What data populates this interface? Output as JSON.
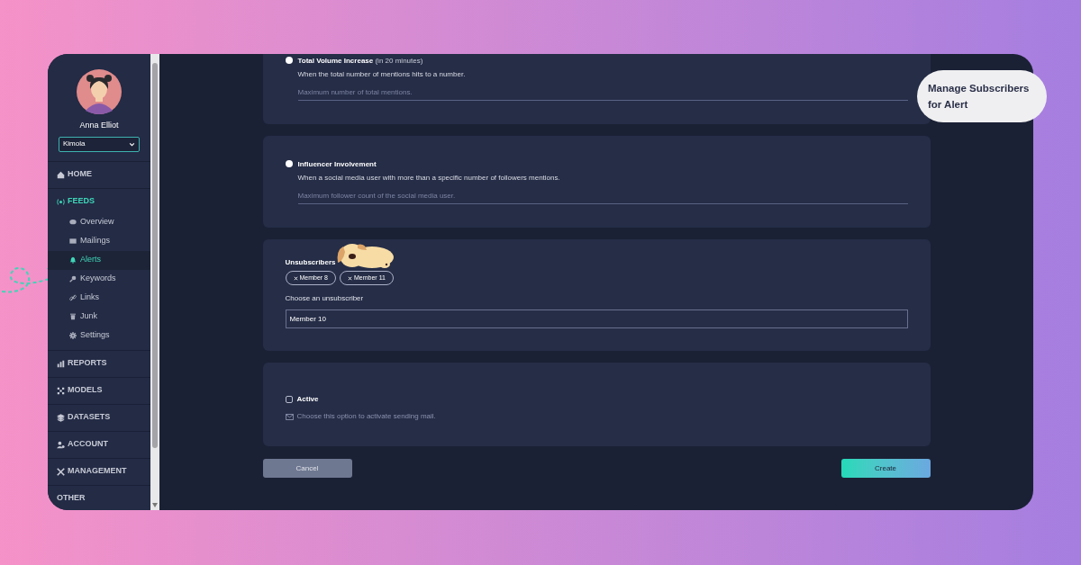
{
  "user": {
    "name": "Anna Elliot"
  },
  "workspace_select": {
    "value": "Kimola"
  },
  "nav": [
    {
      "label": "HOME",
      "selected": false
    },
    {
      "label": "FEEDS",
      "selected": true,
      "children": [
        {
          "label": "Overview",
          "selected": false
        },
        {
          "label": "Mailings",
          "selected": false
        },
        {
          "label": "Alerts",
          "selected": true
        },
        {
          "label": "Keywords",
          "selected": false
        },
        {
          "label": "Links",
          "selected": false
        },
        {
          "label": "Junk",
          "selected": false
        },
        {
          "label": "Settings",
          "selected": false
        }
      ]
    },
    {
      "label": "REPORTS",
      "selected": false
    },
    {
      "label": "MODELS",
      "selected": false
    },
    {
      "label": "DATASETS",
      "selected": false
    },
    {
      "label": "ACCOUNT",
      "selected": false
    },
    {
      "label": "MANAGEMENT",
      "selected": false
    },
    {
      "label": "OTHER",
      "selected": false
    }
  ],
  "alert_options": [
    {
      "title": "Total Volume Increase",
      "note": "(in 20 minutes)",
      "description": "When the total number of mentions hits to a number.",
      "placeholder": "Maximum number of total mentions.",
      "selected": false
    },
    {
      "title": "Influencer Involvement",
      "description": "When a social media user with more than a specific number of followers mentions.",
      "placeholder": "Maximum follower count of the social media user.",
      "selected": false
    }
  ],
  "unsubscribers": {
    "label": "Unsubscribers",
    "tags": [
      "Member 8",
      "Member 11"
    ],
    "choose_label": "Choose an unsubscriber",
    "value": "Member 10"
  },
  "active": {
    "label": "Active",
    "checked": false,
    "hint": "Choose this option to activate sending mail."
  },
  "buttons": {
    "cancel": "Cancel",
    "create": "Create"
  },
  "callout": {
    "text": "Manage Subscribers for Alert"
  }
}
